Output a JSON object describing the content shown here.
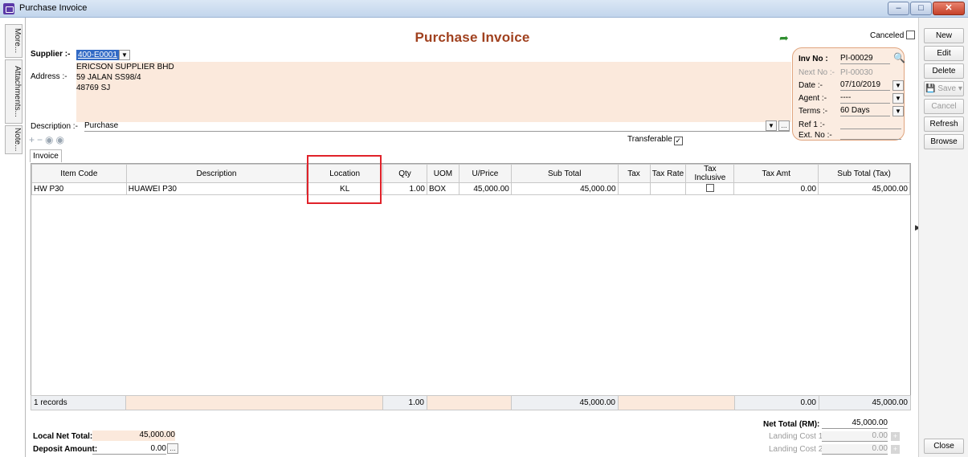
{
  "window": {
    "title": "Purchase Invoice",
    "controls": [
      "–",
      "□",
      "✕"
    ]
  },
  "side_tabs": [
    "More...",
    "Attachments...",
    "Note..."
  ],
  "header": {
    "title": "Purchase Invoice",
    "cancelled_label": "Canceled"
  },
  "supplier": {
    "label": "Supplier :-",
    "code": "400-E0001",
    "name": "ERICSON SUPPLIER BHD",
    "address_label": "Address :-",
    "address_line1": "59 JALAN SS98/4",
    "address_line2": "48769 SJ"
  },
  "description": {
    "label": "Description :-",
    "value": "Purchase"
  },
  "invoice_info": {
    "inv_no_label": "Inv No :",
    "inv_no": "PI-00029",
    "next_no_label": "Next No :-",
    "next_no": "PI-00030",
    "date_label": "Date :-",
    "date": "07/10/2019",
    "agent_label": "Agent :-",
    "agent": "----",
    "terms_label": "Terms :-",
    "terms": "60 Days",
    "ref1_label": "Ref 1 :-",
    "ref1": "",
    "extno_label": "Ext. No :-",
    "extno": ""
  },
  "toolbar": {
    "transferable_label": "Transferable",
    "transferable_checked": true,
    "tab_invoice": "Invoice"
  },
  "grid": {
    "columns": [
      "Item Code",
      "Description",
      "Location",
      "Qty",
      "UOM",
      "U/Price",
      "Sub Total",
      "Tax",
      "Tax Rate",
      "Tax Inclusive",
      "Tax Amt",
      "Sub Total (Tax)"
    ],
    "rows": [
      {
        "item_code": "HW P30",
        "description": "HUAWEI P30",
        "location": "KL",
        "qty": "1.00",
        "uom": "BOX",
        "uprice": "45,000.00",
        "subtotal": "45,000.00",
        "tax": "",
        "tax_rate": "",
        "tax_amt": "0.00",
        "subtotal_tax": "45,000.00"
      }
    ],
    "footer": {
      "records": "1 records",
      "qty": "1.00",
      "subtotal": "45,000.00",
      "tax_amt": "0.00",
      "subtotal_tax": "45,000.00"
    }
  },
  "totals": {
    "local_net_label": "Local Net Total:",
    "local_net": "45,000.00",
    "deposit_label": "Deposit Amount:",
    "deposit": "0.00",
    "net_total_label": "Net Total (RM):",
    "net_total": "45,000.00",
    "landing1_label": "Landing Cost 1:",
    "landing1": "0.00",
    "landing2_label": "Landing Cost 2:",
    "landing2": "0.00"
  },
  "right_buttons": {
    "new": "New",
    "edit": "Edit",
    "delete": "Delete",
    "save": "Save",
    "cancel": "Cancel",
    "refresh": "Refresh",
    "browse": "Browse",
    "close": "Close"
  },
  "colors": {
    "title_accent": "#a0411f",
    "highlight": "#e0222a",
    "peach": "#fbe9dc",
    "selection": "#316ac5"
  }
}
